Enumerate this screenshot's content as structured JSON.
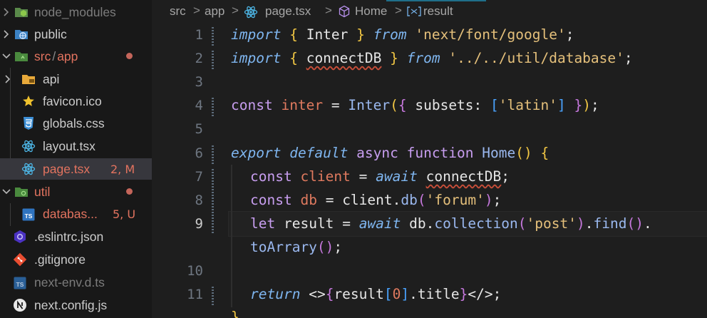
{
  "sidebar": {
    "items": [
      {
        "label": "node_modules",
        "icon": "folder-node-icon",
        "dimmed": true
      },
      {
        "label": "public",
        "icon": "folder-globe-icon"
      },
      {
        "label": "src",
        "label2": "app",
        "sep": "/",
        "icon": "folder-src-icon",
        "modified": true
      },
      {
        "label": "api",
        "icon": "folder-api-icon"
      },
      {
        "label": "favicon.ico",
        "icon": "star-icon"
      },
      {
        "label": "globals.css",
        "icon": "css-icon"
      },
      {
        "label": "layout.tsx",
        "icon": "react-icon"
      },
      {
        "label": "page.tsx",
        "icon": "react-icon",
        "badge": "2, M",
        "active": true
      },
      {
        "label": "util",
        "icon": "folder-util-icon",
        "modified": true
      },
      {
        "label": "databas...",
        "icon": "ts-icon",
        "badge": "5, U"
      },
      {
        "label": ".eslintrc.json",
        "icon": "eslint-icon"
      },
      {
        "label": ".gitignore",
        "icon": "git-icon"
      },
      {
        "label": "next-env.d.ts",
        "icon": "ts-icon",
        "dimmed": true
      },
      {
        "label": "next.config.js",
        "icon": "next-icon"
      }
    ]
  },
  "breadcrumb": {
    "items": [
      "src",
      "app",
      "page.tsx",
      "Home",
      "result"
    ],
    "separator": ">"
  },
  "editor": {
    "line_numbers": [
      "1",
      "2",
      "3",
      "4",
      "5",
      "6",
      "7",
      "8",
      "9",
      "",
      "10",
      "11",
      ""
    ],
    "current_line": "9",
    "code": {
      "l1": {
        "import": "import",
        "ob": "{",
        "name": "Inter",
        "cb": "}",
        "from": "from",
        "str": "'next/font/google'",
        "semi": ";"
      },
      "l2": {
        "import": "import",
        "ob": "{",
        "name": "connectDB",
        "cb": "}",
        "from": "from",
        "str": "'../../util/database'",
        "semi": ";"
      },
      "l4": {
        "const": "const",
        "var": "inter",
        "eq": "=",
        "fn": "Inter",
        "p1": "(",
        "ob": "{",
        "prop": "subsets",
        "colon": ":",
        "sb1": "[",
        "str": "'latin'",
        "sb2": "]",
        "cb": "}",
        "p2": ")",
        "semi": ";"
      },
      "l6": {
        "export": "export",
        "default": "default",
        "async": "async",
        "function": "function",
        "fn": "Home",
        "parens": "()",
        "ob": "{"
      },
      "l7": {
        "const": "const",
        "var": "client",
        "eq": "=",
        "await": "await",
        "name": "connectDB",
        "semi": ";"
      },
      "l8": {
        "const": "const",
        "var": "db",
        "eq": "=",
        "obj": "client",
        "dot": ".",
        "fn": "db",
        "p1": "(",
        "str": "'forum'",
        "p2": ")",
        "semi": ";"
      },
      "l9": {
        "let": "let",
        "name": "result",
        "eq": "=",
        "await": "await",
        "obj": "db",
        "dot1": ".",
        "fn1": "collection",
        "p1": "(",
        "str": "'post'",
        "p2": ")",
        "dot2": ".",
        "fn2": "find",
        "parens": "()",
        "dot3": "."
      },
      "l9b": {
        "fn": "toArrary",
        "parens": "()",
        "semi": ";"
      },
      "l11": {
        "return": "return",
        "open": "<>",
        "ob": "{",
        "name": "result",
        "sb1": "[",
        "num": "0",
        "sb2": "]",
        "dot": ".",
        "prop": "title",
        "cb": "}",
        "close": "</>",
        "semi": ";"
      },
      "l12": {
        "cb": "}"
      }
    }
  },
  "colors": {
    "background": "#1e1e1e",
    "sidebar": "#181818",
    "modified": "#e2735f",
    "keyword_italic": "#7fb6f0",
    "keyword": "#c89ef0",
    "string": "#e5c07b",
    "variable": "#e07a5f"
  }
}
